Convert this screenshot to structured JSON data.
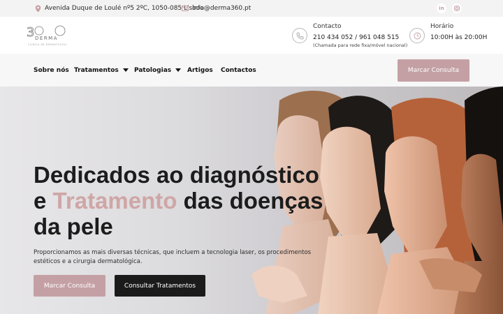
{
  "topbar": {
    "address": "Avenida Duque de Loulé nº5 2ºC, 1050-085 Lisboa",
    "email": "info@derma360.pt",
    "social": [
      "in",
      "ig"
    ]
  },
  "header": {
    "logo_text": "360 DERMA",
    "logo_sub": "CLÍNICA DE DERMATOLOGIA",
    "contact": {
      "label": "Contacto",
      "phones": "210 434 052 / 961 048 515",
      "note": "(Chamada para rede fixa/móvel nacional)"
    },
    "hours": {
      "label": "Horário",
      "value": "10:00H às 20:00H"
    }
  },
  "nav": {
    "items": [
      {
        "label": "Sobre nós",
        "dropdown": false
      },
      {
        "label": "Tratamentos",
        "dropdown": true
      },
      {
        "label": "Patologias",
        "dropdown": true
      },
      {
        "label": "Artigos",
        "dropdown": false
      },
      {
        "label": "Contactos",
        "dropdown": false
      }
    ],
    "cta": "Marcar Consulta"
  },
  "hero": {
    "title_part1": "Dedicados ao diagnóstico",
    "title_part2_prefix": "e ",
    "title_accent": "Tratamento",
    "title_part2_suffix": " das doenças",
    "title_part3": "da pele",
    "description": "Proporcionamos as mais diversas técnicas, que incluem a tecnologia laser, os procedimentos estéticos e a cirurgia dermatológica.",
    "btn_primary": "Marcar Consulta",
    "btn_secondary": "Consultar Tratamentos"
  },
  "colors": {
    "accent": "#c4a0a4",
    "dark_button": "#1b1b1b",
    "topbar_bg": "#f4f3f3",
    "nav_bg": "#f7f7f7"
  }
}
